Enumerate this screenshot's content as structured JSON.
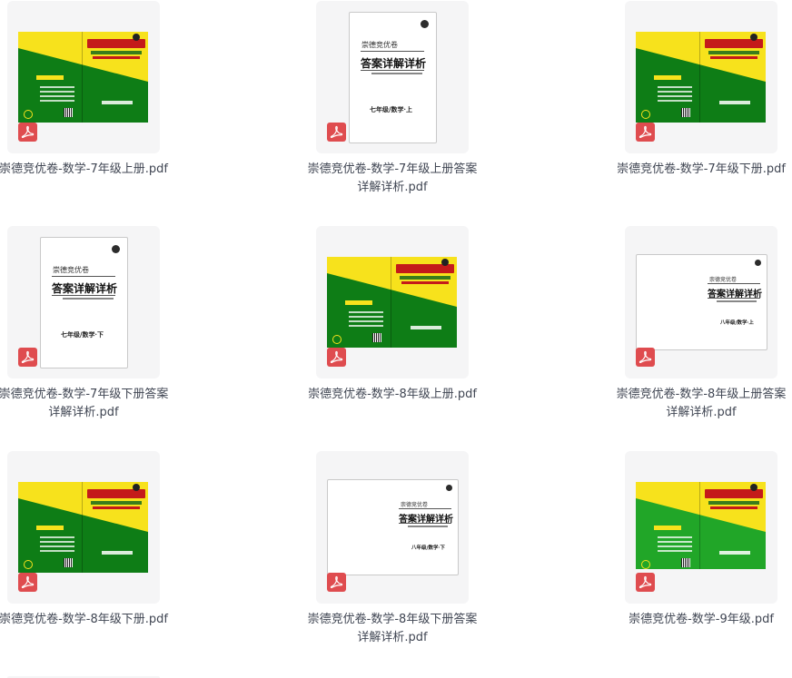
{
  "files": [
    {
      "name": "崇德竞优卷-数学-7年级上册.pdf",
      "cover": "green"
    },
    {
      "name": "崇德竞优卷-数学-7年级上册答案详解详析.pdf",
      "cover": "white",
      "cover_small": "崇德竞优卷",
      "cover_big": "答案详解详析",
      "cover_grade": "七年级/数学·上"
    },
    {
      "name": "崇德竞优卷-数学-7年级下册.pdf",
      "cover": "green"
    },
    {
      "name": "崇德竞优卷-数学-7年级下册答案详解详析.pdf",
      "cover": "white",
      "cover_small": "崇德竞优卷",
      "cover_big": "答案详解详析",
      "cover_grade": "七年级/数学·下"
    },
    {
      "name": "崇德竞优卷-数学-8年级上册.pdf",
      "cover": "green"
    },
    {
      "name": "崇德竞优卷-数学-8年级上册答案详解详析.pdf",
      "cover": "white",
      "cover_small": "崇德竞优卷",
      "cover_big": "答案详解详析",
      "cover_grade": "八年级/数学·上"
    },
    {
      "name": "崇德竞优卷-数学-8年级下册.pdf",
      "cover": "green"
    },
    {
      "name": "崇德竞优卷-数学-8年级下册答案详解详析.pdf",
      "cover": "white",
      "cover_small": "崇德竞优卷",
      "cover_big": "答案详解详析",
      "cover_grade": "八年级/数学·下"
    },
    {
      "name": "崇德竞优卷-数学-9年级.pdf",
      "cover": "green-light"
    }
  ],
  "file_icon": "pdf-icon",
  "colors": {
    "pdf_badge": "#df4c4f",
    "cover_green": "#0e7d16",
    "cover_yellow": "#f7e21c",
    "cover_title_red": "#c41a1a"
  }
}
